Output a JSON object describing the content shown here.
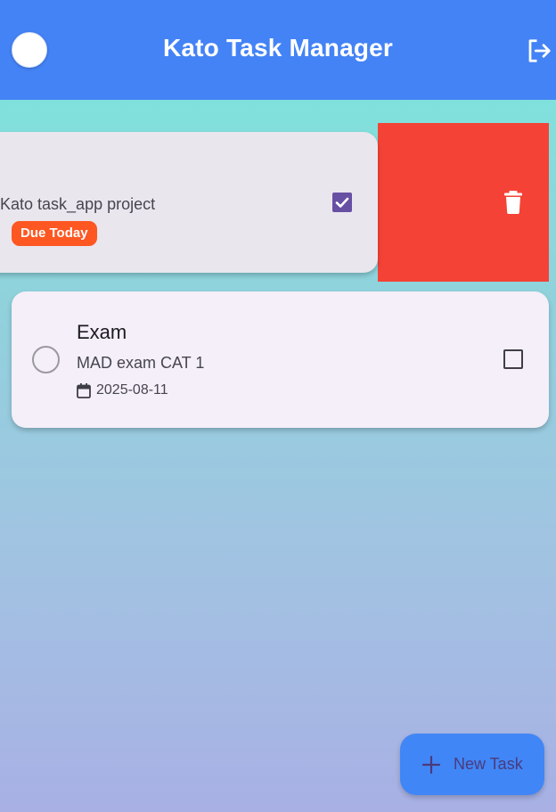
{
  "app_bar": {
    "title": "Kato Task Manager",
    "avatar_icon": "avatar-icon",
    "logout_icon": "logout-icon",
    "color": "#4483f6"
  },
  "tasks": [
    {
      "description": "Kato task_app project",
      "badge": "Due Today",
      "badge_color": "#fe5722",
      "completed": true,
      "swipe_action": {
        "icon": "trash-icon",
        "color": "#f44336"
      }
    },
    {
      "title": "Exam",
      "description": "MAD exam CAT 1",
      "date": "2025-08-11",
      "date_icon": "calendar-icon",
      "completed": false
    }
  ],
  "fab": {
    "label": "New Task",
    "icon": "plus-icon",
    "color": "#4186f6"
  }
}
